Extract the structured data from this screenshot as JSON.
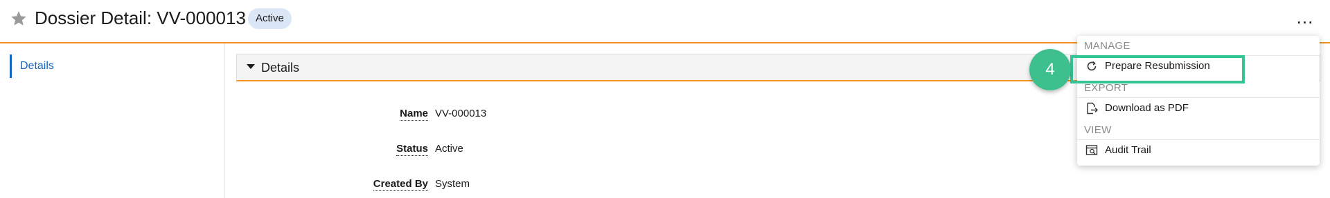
{
  "header": {
    "title": "Dossier Detail: VV-000013",
    "status_badge": "Active",
    "more_label": "..."
  },
  "sidebar": {
    "items": [
      {
        "label": "Details",
        "selected": true
      }
    ]
  },
  "section": {
    "title": "Details",
    "fields": [
      {
        "label": "Name",
        "value": "VV-000013"
      },
      {
        "label": "Status",
        "value": "Active"
      },
      {
        "label": "Created By",
        "value": "System"
      }
    ]
  },
  "menu": {
    "groups": [
      {
        "name": "MANAGE",
        "items": [
          {
            "label": "Prepare Resubmission",
            "icon": "refresh-icon"
          }
        ]
      },
      {
        "name": "EXPORT",
        "items": [
          {
            "label": "Download as PDF",
            "icon": "export-document-icon"
          }
        ]
      },
      {
        "name": "VIEW",
        "items": [
          {
            "label": "Audit Trail",
            "icon": "audit-trail-icon"
          }
        ]
      }
    ]
  },
  "step_marker": {
    "label": "4"
  },
  "colors": {
    "accent_orange": "#f5901e",
    "link_blue": "#1565c0",
    "badge_bg": "#dbe6f7",
    "highlight_green": "#35c496",
    "step_green": "#3dbf8e"
  }
}
